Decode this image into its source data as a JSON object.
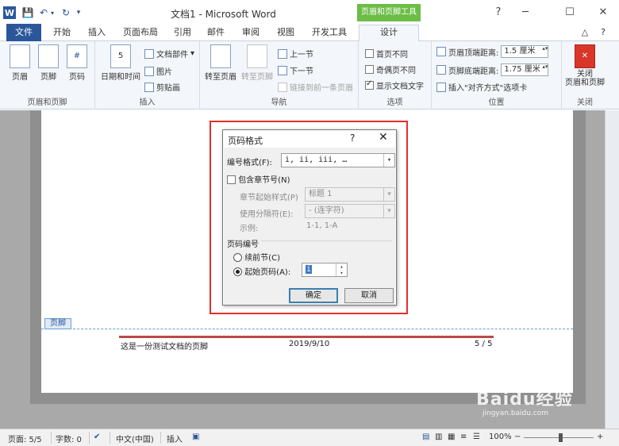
{
  "window": {
    "title": "文档1 - Microsoft Word",
    "context_tool": "页眉和页脚工具",
    "app_icon": "W"
  },
  "tabs": [
    "文件",
    "开始",
    "插入",
    "页面布局",
    "引用",
    "邮件",
    "审阅",
    "视图",
    "开发工具",
    "设计"
  ],
  "ribbon": {
    "groups": {
      "header_footer": {
        "label": "页眉和页脚",
        "buttons": [
          "页眉",
          "页脚",
          "页码"
        ]
      },
      "insert": {
        "label": "插入",
        "date_time": "日期和时间",
        "doc_parts": "文档部件",
        "picture": "图片",
        "clipart": "剪贴画"
      },
      "navigation": {
        "label": "导航",
        "goto_header": "转至页眉",
        "goto_footer": "转至页脚",
        "prev_section": "上一节",
        "next_section": "下一节",
        "link_prev": "链接到前一条页眉"
      },
      "options": {
        "label": "选项",
        "first_page": "首页不同",
        "odd_even": "奇偶页不同",
        "show_text": "显示文档文字",
        "first_page_checked": false,
        "odd_even_checked": false,
        "show_text_checked": true
      },
      "position": {
        "label": "位置",
        "header_top_label": "页眉顶端距离:",
        "header_top_value": "1.5 厘米",
        "footer_bottom_label": "页脚底端距离:",
        "footer_bottom_value": "1.75 厘米",
        "align_tab": "插入\"对齐方式\"选项卡"
      },
      "close": {
        "label": "关闭",
        "button": "关闭\n页眉和页脚"
      }
    }
  },
  "document": {
    "footer_tag": "页脚",
    "footer_left": "这是一份测试文档的页脚",
    "footer_date": "2019/9/10",
    "footer_page": "5 / 5"
  },
  "dialog": {
    "title": "页码格式",
    "help": "?",
    "close": "✕",
    "number_format_label": "编号格式(F):",
    "number_format_value": "i, ii, iii, …",
    "include_chapter_label": "包含章节号(N)",
    "chapter_style_label": "章节起始样式(P)",
    "chapter_style_value": "标题 1",
    "separator_label": "使用分隔符(E):",
    "separator_value": "-  (连字符)",
    "example_label": "示例:",
    "example_value": "1-1, 1-A",
    "page_numbering_label": "页码编号",
    "continue_label": "续前节(C)",
    "start_at_label": "起始页码(A):",
    "start_at_value": "i",
    "ok": "确定",
    "cancel": "取消"
  },
  "statusbar": {
    "page": "页面: 5/5",
    "words": "字数: 0",
    "language": "中文(中国)",
    "mode": "插入",
    "zoom": "100%",
    "zoom_minus": "−",
    "zoom_plus": "+"
  },
  "watermark": {
    "logo": "Baidu经验",
    "url": "jingyan.baidu.com"
  },
  "colors": {
    "accent": "#2b579a",
    "context_green": "#6bbd46",
    "highlight_red": "#e3302a"
  }
}
